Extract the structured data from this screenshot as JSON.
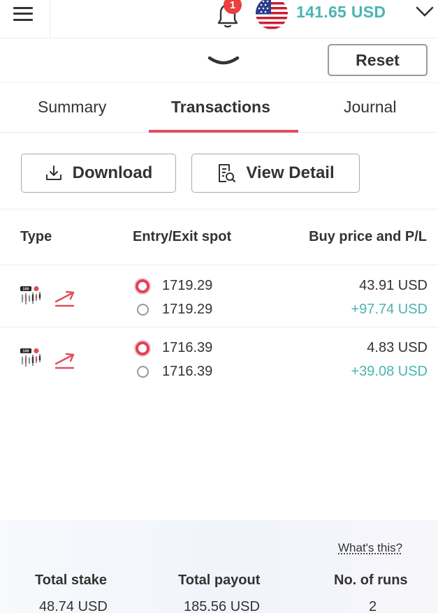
{
  "header": {
    "notification_count": "1",
    "balance": "141.65 USD",
    "currency_flag": "us-flag-icon"
  },
  "controls": {
    "reset_label": "Reset"
  },
  "tabs": [
    {
      "label": "Summary",
      "active": false
    },
    {
      "label": "Transactions",
      "active": true
    },
    {
      "label": "Journal",
      "active": false
    }
  ],
  "actions": {
    "download_label": "Download",
    "view_detail_label": "View Detail"
  },
  "table": {
    "columns": [
      "Type",
      "Entry/Exit spot",
      "Buy price and P/L"
    ],
    "rows": [
      {
        "type_icon": "chart-100-icon",
        "direction_icon": "rise-arrow-icon",
        "entry_spot": "1719.29",
        "exit_spot": "1719.29",
        "buy_price": "43.91 USD",
        "profit_loss": "+97.74 USD"
      },
      {
        "type_icon": "chart-100-icon",
        "direction_icon": "rise-arrow-icon",
        "entry_spot": "1716.39",
        "exit_spot": "1716.39",
        "buy_price": "4.83 USD",
        "profit_loss": "+39.08 USD"
      }
    ]
  },
  "summary": {
    "whats_this": "What's this?",
    "total_stake_label": "Total stake",
    "total_stake_value": "48.74 USD",
    "total_payout_label": "Total payout",
    "total_payout_value": "185.56 USD",
    "runs_label": "No. of runs",
    "runs_value": "2"
  },
  "colors": {
    "accent": "#4bb4b3",
    "brand_red": "#e24d5b",
    "profit": "#4bb4b3"
  }
}
